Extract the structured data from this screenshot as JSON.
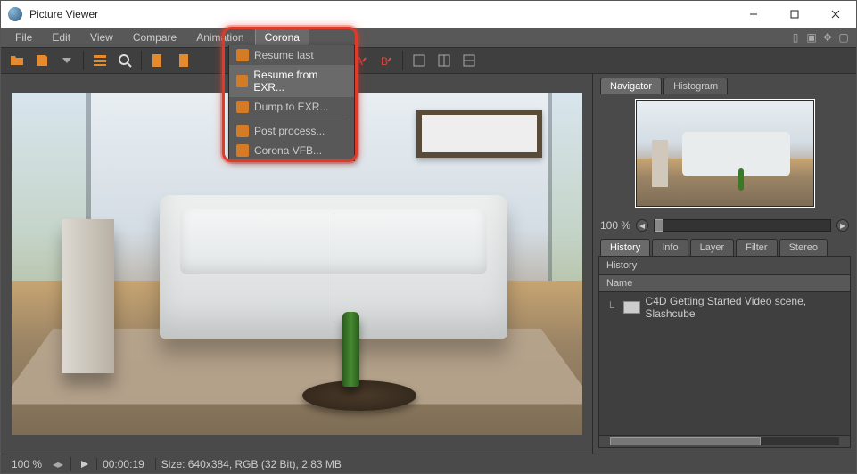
{
  "window": {
    "title": "Picture Viewer"
  },
  "menu": {
    "items": [
      "File",
      "Edit",
      "View",
      "Compare",
      "Animation",
      "Corona"
    ],
    "active": 5
  },
  "dropdown": {
    "items": [
      {
        "label": "Resume last"
      },
      {
        "label": "Resume from EXR...",
        "highlight": true
      },
      {
        "label": "Dump to EXR..."
      }
    ],
    "items2": [
      {
        "label": "Post process..."
      },
      {
        "label": "Corona VFB..."
      }
    ]
  },
  "side": {
    "tabs1": [
      "Navigator",
      "Histogram"
    ],
    "tabs1_active": 0,
    "zoom": "100 %",
    "tabs2": [
      "History",
      "Info",
      "Layer",
      "Filter",
      "Stereo"
    ],
    "tabs2_active": 0,
    "history_title": "History",
    "history_header": "Name",
    "history_rows": [
      {
        "name": "C4D Getting Started Video scene, Slashcube"
      }
    ]
  },
  "status": {
    "zoom": "100 %",
    "time": "00:00:19",
    "info": "Size: 640x384, RGB (32 Bit), 2.83 MB"
  }
}
